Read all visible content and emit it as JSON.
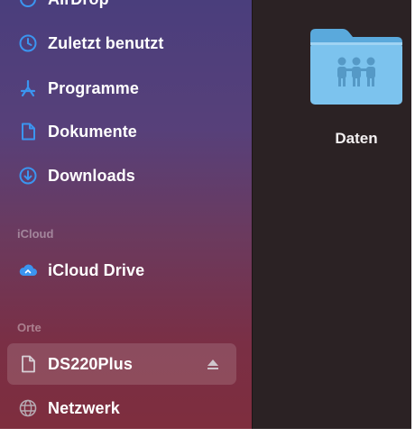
{
  "sidebar": {
    "partial_top_item": "AirDrop",
    "favorites": [
      {
        "label": "Zuletzt benutzt",
        "icon": "clock-icon"
      },
      {
        "label": "Programme",
        "icon": "apps-icon"
      },
      {
        "label": "Dokumente",
        "icon": "document-icon"
      },
      {
        "label": "Downloads",
        "icon": "download-icon"
      }
    ],
    "icloud_section": "iCloud",
    "icloud_items": [
      {
        "label": "iCloud Drive",
        "icon": "cloud-icon"
      }
    ],
    "locations_section": "Orte",
    "locations": [
      {
        "label": "DS220Plus",
        "icon": "server-document-icon",
        "selected": true,
        "eject": true
      },
      {
        "label": "Netzwerk",
        "icon": "globe-icon"
      }
    ]
  },
  "content": {
    "items": [
      {
        "label": "Daten",
        "icon": "shared-folder-icon"
      }
    ]
  },
  "colors": {
    "accent": "#3b95f0",
    "sidebar_top": "#4a3e7c",
    "sidebar_bottom": "#7e2e3e",
    "content_bg": "#2b2224",
    "folder": "#7cc3ee"
  }
}
